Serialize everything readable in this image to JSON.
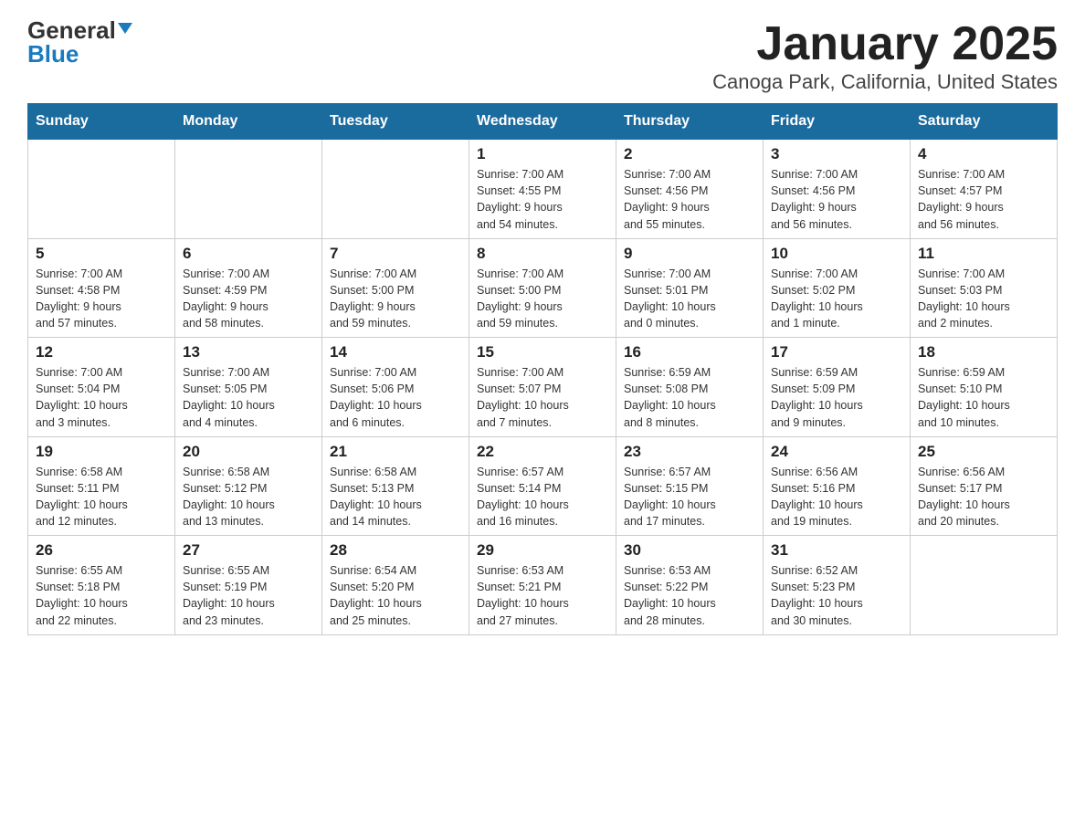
{
  "logo": {
    "general": "General",
    "blue": "Blue"
  },
  "title": "January 2025",
  "subtitle": "Canoga Park, California, United States",
  "days_of_week": [
    "Sunday",
    "Monday",
    "Tuesday",
    "Wednesday",
    "Thursday",
    "Friday",
    "Saturday"
  ],
  "weeks": [
    [
      {
        "day": "",
        "info": ""
      },
      {
        "day": "",
        "info": ""
      },
      {
        "day": "",
        "info": ""
      },
      {
        "day": "1",
        "info": "Sunrise: 7:00 AM\nSunset: 4:55 PM\nDaylight: 9 hours\nand 54 minutes."
      },
      {
        "day": "2",
        "info": "Sunrise: 7:00 AM\nSunset: 4:56 PM\nDaylight: 9 hours\nand 55 minutes."
      },
      {
        "day": "3",
        "info": "Sunrise: 7:00 AM\nSunset: 4:56 PM\nDaylight: 9 hours\nand 56 minutes."
      },
      {
        "day": "4",
        "info": "Sunrise: 7:00 AM\nSunset: 4:57 PM\nDaylight: 9 hours\nand 56 minutes."
      }
    ],
    [
      {
        "day": "5",
        "info": "Sunrise: 7:00 AM\nSunset: 4:58 PM\nDaylight: 9 hours\nand 57 minutes."
      },
      {
        "day": "6",
        "info": "Sunrise: 7:00 AM\nSunset: 4:59 PM\nDaylight: 9 hours\nand 58 minutes."
      },
      {
        "day": "7",
        "info": "Sunrise: 7:00 AM\nSunset: 5:00 PM\nDaylight: 9 hours\nand 59 minutes."
      },
      {
        "day": "8",
        "info": "Sunrise: 7:00 AM\nSunset: 5:00 PM\nDaylight: 9 hours\nand 59 minutes."
      },
      {
        "day": "9",
        "info": "Sunrise: 7:00 AM\nSunset: 5:01 PM\nDaylight: 10 hours\nand 0 minutes."
      },
      {
        "day": "10",
        "info": "Sunrise: 7:00 AM\nSunset: 5:02 PM\nDaylight: 10 hours\nand 1 minute."
      },
      {
        "day": "11",
        "info": "Sunrise: 7:00 AM\nSunset: 5:03 PM\nDaylight: 10 hours\nand 2 minutes."
      }
    ],
    [
      {
        "day": "12",
        "info": "Sunrise: 7:00 AM\nSunset: 5:04 PM\nDaylight: 10 hours\nand 3 minutes."
      },
      {
        "day": "13",
        "info": "Sunrise: 7:00 AM\nSunset: 5:05 PM\nDaylight: 10 hours\nand 4 minutes."
      },
      {
        "day": "14",
        "info": "Sunrise: 7:00 AM\nSunset: 5:06 PM\nDaylight: 10 hours\nand 6 minutes."
      },
      {
        "day": "15",
        "info": "Sunrise: 7:00 AM\nSunset: 5:07 PM\nDaylight: 10 hours\nand 7 minutes."
      },
      {
        "day": "16",
        "info": "Sunrise: 6:59 AM\nSunset: 5:08 PM\nDaylight: 10 hours\nand 8 minutes."
      },
      {
        "day": "17",
        "info": "Sunrise: 6:59 AM\nSunset: 5:09 PM\nDaylight: 10 hours\nand 9 minutes."
      },
      {
        "day": "18",
        "info": "Sunrise: 6:59 AM\nSunset: 5:10 PM\nDaylight: 10 hours\nand 10 minutes."
      }
    ],
    [
      {
        "day": "19",
        "info": "Sunrise: 6:58 AM\nSunset: 5:11 PM\nDaylight: 10 hours\nand 12 minutes."
      },
      {
        "day": "20",
        "info": "Sunrise: 6:58 AM\nSunset: 5:12 PM\nDaylight: 10 hours\nand 13 minutes."
      },
      {
        "day": "21",
        "info": "Sunrise: 6:58 AM\nSunset: 5:13 PM\nDaylight: 10 hours\nand 14 minutes."
      },
      {
        "day": "22",
        "info": "Sunrise: 6:57 AM\nSunset: 5:14 PM\nDaylight: 10 hours\nand 16 minutes."
      },
      {
        "day": "23",
        "info": "Sunrise: 6:57 AM\nSunset: 5:15 PM\nDaylight: 10 hours\nand 17 minutes."
      },
      {
        "day": "24",
        "info": "Sunrise: 6:56 AM\nSunset: 5:16 PM\nDaylight: 10 hours\nand 19 minutes."
      },
      {
        "day": "25",
        "info": "Sunrise: 6:56 AM\nSunset: 5:17 PM\nDaylight: 10 hours\nand 20 minutes."
      }
    ],
    [
      {
        "day": "26",
        "info": "Sunrise: 6:55 AM\nSunset: 5:18 PM\nDaylight: 10 hours\nand 22 minutes."
      },
      {
        "day": "27",
        "info": "Sunrise: 6:55 AM\nSunset: 5:19 PM\nDaylight: 10 hours\nand 23 minutes."
      },
      {
        "day": "28",
        "info": "Sunrise: 6:54 AM\nSunset: 5:20 PM\nDaylight: 10 hours\nand 25 minutes."
      },
      {
        "day": "29",
        "info": "Sunrise: 6:53 AM\nSunset: 5:21 PM\nDaylight: 10 hours\nand 27 minutes."
      },
      {
        "day": "30",
        "info": "Sunrise: 6:53 AM\nSunset: 5:22 PM\nDaylight: 10 hours\nand 28 minutes."
      },
      {
        "day": "31",
        "info": "Sunrise: 6:52 AM\nSunset: 5:23 PM\nDaylight: 10 hours\nand 30 minutes."
      },
      {
        "day": "",
        "info": ""
      }
    ]
  ]
}
